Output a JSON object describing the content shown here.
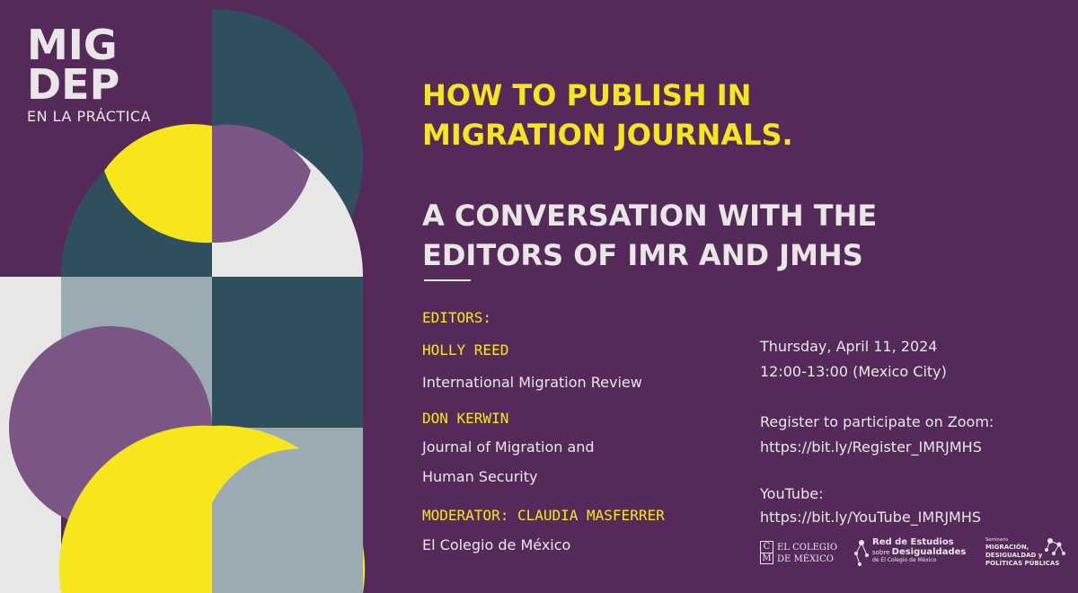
{
  "brand": {
    "line1": "MIG",
    "line2": "DEP",
    "subtitle": "EN LA PRÁCTICA"
  },
  "title": {
    "line1": "HOW TO PUBLISH IN",
    "line2": "MIGRATION JOURNALS."
  },
  "subtitle": {
    "line1": "A CONVERSATION WITH THE",
    "line2": "EDITORS OF IMR AND JMHS"
  },
  "editors": {
    "label": "EDITORS:",
    "people": [
      {
        "name": "HOLLY REED",
        "affiliation_lines": [
          "International Migration Review"
        ]
      },
      {
        "name": "DON KERWIN",
        "affiliation_lines": [
          "Journal of Migration and",
          "Human Security"
        ]
      }
    ]
  },
  "moderator": {
    "label": "MODERATOR: CLAUDIA MASFERRER",
    "affiliation": "El Colegio de México"
  },
  "event": {
    "date": "Thursday, April 11, 2024",
    "time": "12:00-13:00 (Mexico City)",
    "register_label": "Register to participate on Zoom:",
    "register_link": "https://bit.ly/Register_IMRJMHS",
    "youtube_label": "YouTube:",
    "youtube_link": "https://bit.ly/YouTube_IMRJMHS"
  },
  "logos": {
    "colmex": {
      "seal_top": "C",
      "seal_bottom": "M",
      "line1": "EL COLEGIO",
      "line2": "DE MÉXICO"
    },
    "red": {
      "line1": "Red de Estudios",
      "line2_small": "sobre",
      "line2_big": "Desigualdades",
      "line3": "de El Colegio de México"
    },
    "seminario": {
      "line0": "Seminario",
      "line1": "MIGRACIÓN,",
      "line2": "DESIGUALDAD y",
      "line3": "POLÍTICAS PÚBLICAS"
    }
  },
  "colors": {
    "background": "#552a5b",
    "yellow": "#f8e61d",
    "light": "#e9e7e5",
    "teal": "#2f4f5f",
    "lavender": "#7a5586",
    "grey_blue": "#9aabb3"
  }
}
